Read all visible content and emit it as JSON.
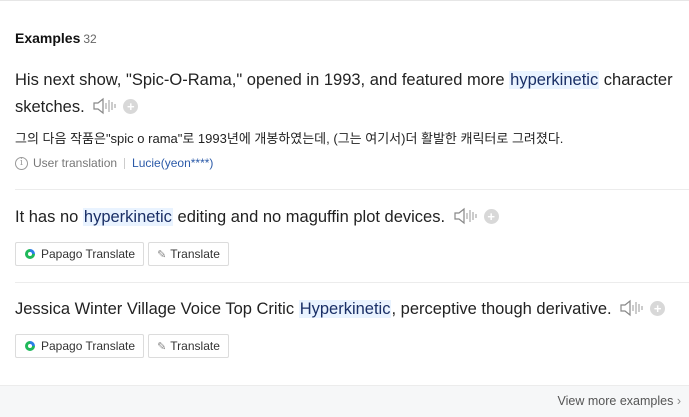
{
  "header": {
    "title": "Examples",
    "count": "32"
  },
  "examples": [
    {
      "before": "His next show, \"Spic-O-Rama,\" opened in 1993, and featured more ",
      "highlight": "hyperkinetic",
      "after": " character sketches.",
      "translation": "그의 다음 작품은\"spic o rama\"로 1993년에 개봉하였는데, (그는 여기서)더 활발한 캐릭터로 그려졌다.",
      "source_label": "User translation",
      "user": "Lucie(yeon****)"
    },
    {
      "before": "It has no ",
      "highlight": "hyperkinetic",
      "after": " editing and no maguffin plot devices.",
      "papago_label": "Papago Translate",
      "translate_label": "Translate"
    },
    {
      "before": "Jessica Winter Village Voice Top Critic ",
      "highlight": "Hyperkinetic",
      "after": ", perceptive though derivative.",
      "papago_label": "Papago Translate",
      "translate_label": "Translate"
    }
  ],
  "footer": {
    "view_more": "View more examples"
  },
  "icons": {
    "speaker": "speaker-icon",
    "plus": "plus-icon",
    "info": "info-icon",
    "papago": "papago-logo-icon",
    "pencil": "pencil-icon",
    "chevron": "chevron-right-icon"
  },
  "colors": {
    "highlight_bg": "#e9f3ff",
    "link": "#2b5aa8"
  }
}
